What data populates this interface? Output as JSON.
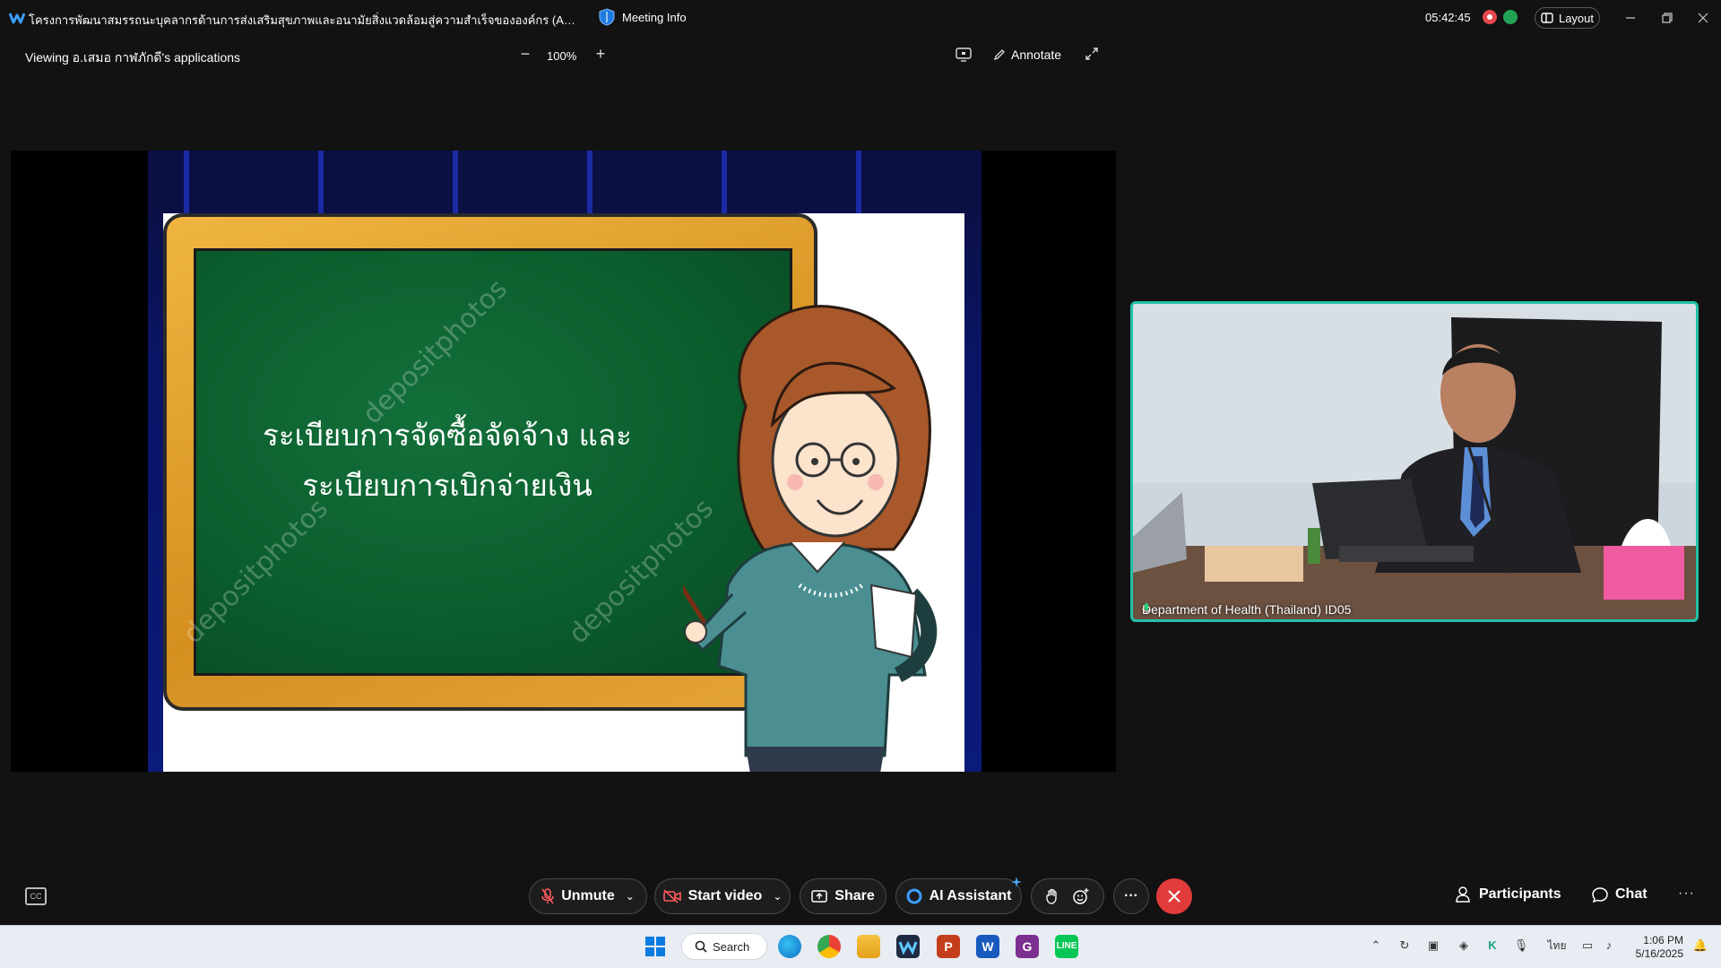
{
  "titlebar": {
    "meeting_title": "โครงการพัฒนาสมรรถนะบุคลากรด้านการส่งเสริมสุขภาพและอนามัยสิ่งแวดล้อมสู่ความสำเร็จขององค์กร (Agility, Advanc...",
    "meeting_info_label": "Meeting Info",
    "clock": "05:42:45",
    "layout_label": "Layout"
  },
  "share_header": {
    "viewing_label": "Viewing อ.เสมอ กาฬภักดี's applications",
    "zoom_value": "100%",
    "annotate_label": "Annotate"
  },
  "slide": {
    "line1": "ระเบียบการจัดซื้อจัดจ้าง และ",
    "line2": "ระเบียบการเบิกจ่ายเงิน",
    "watermark": "depositphotos"
  },
  "video": {
    "participant_name": "Department of Health (Thailand) ID05"
  },
  "controls": {
    "unmute": "Unmute",
    "start_video": "Start video",
    "share": "Share",
    "ai_assistant": "AI Assistant",
    "participants": "Participants",
    "chat": "Chat",
    "more": "···"
  },
  "taskbar": {
    "search_label": "Search",
    "language": "ไทย",
    "time": "1:06 PM",
    "date": "5/16/2025"
  },
  "colors": {
    "accent_teal": "#22c0a8",
    "end_call_red": "#e23b3b",
    "chalkboard_green": "#0b5e2d",
    "frame_orange": "#e3a030"
  }
}
